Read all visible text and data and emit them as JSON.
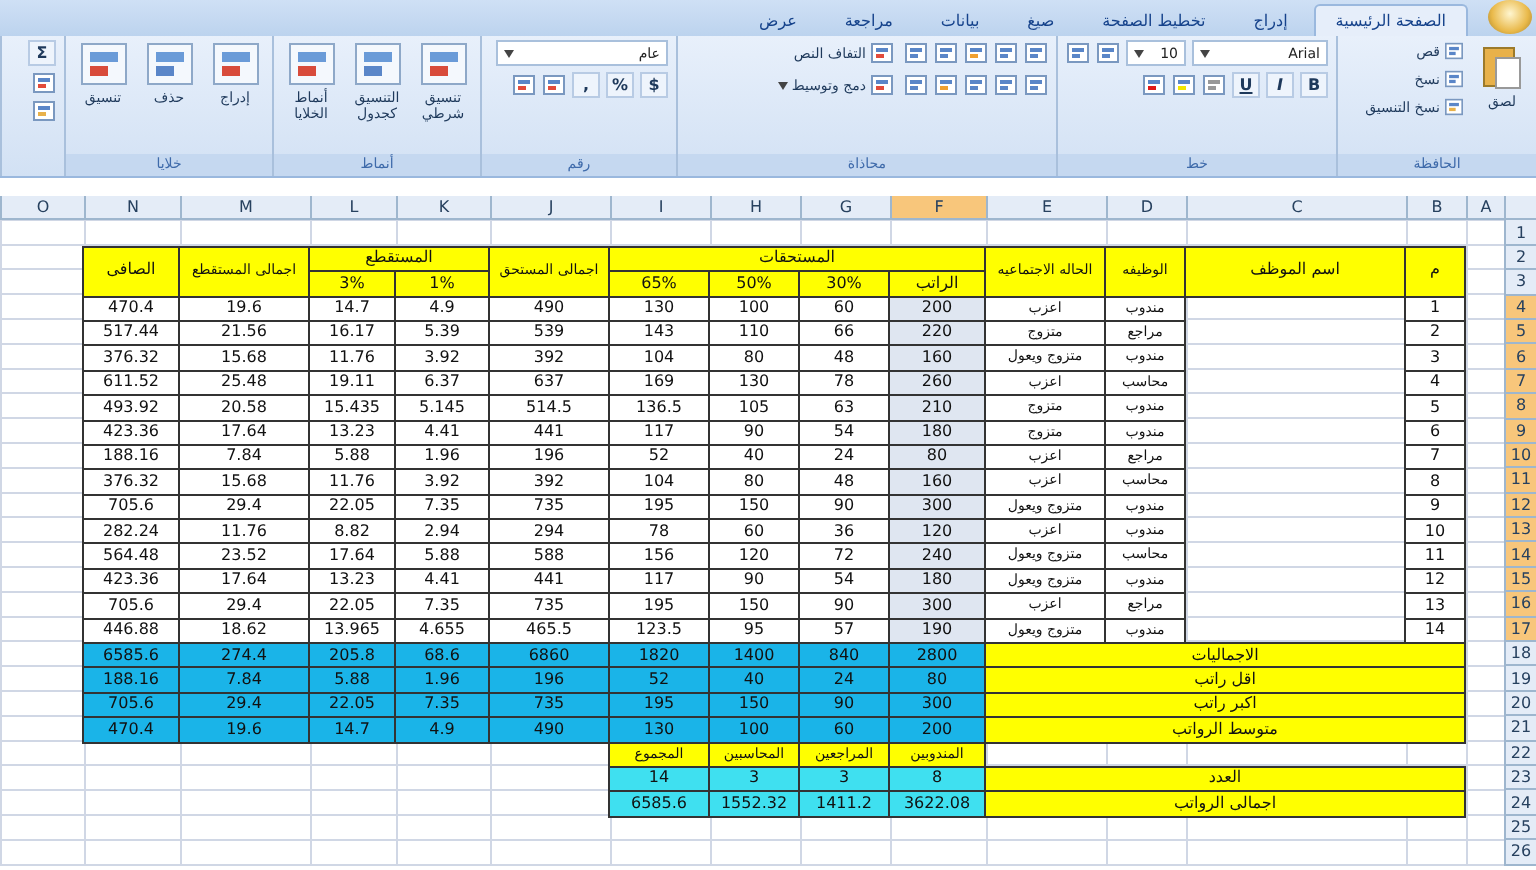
{
  "ribbon": {
    "tabs": [
      {
        "label": "الصفحة الرئيسية",
        "selected": true
      },
      {
        "label": "إدراج",
        "selected": false
      },
      {
        "label": "تخطيط الصفحة",
        "selected": false
      },
      {
        "label": "صيغ",
        "selected": false
      },
      {
        "label": "بيانات",
        "selected": false
      },
      {
        "label": "مراجعة",
        "selected": false
      },
      {
        "label": "عرض",
        "selected": false
      }
    ],
    "groups": [
      {
        "kind": "clipboard",
        "title": "الحافظة",
        "paste": "لصق",
        "items": [
          "قص",
          "نسخ",
          "نسخ التنسيق"
        ]
      },
      {
        "kind": "font",
        "title": "خط",
        "font_name": "Arial",
        "font_size": "10",
        "format_buttons": [
          "B",
          "I",
          "U"
        ]
      },
      {
        "kind": "alignment",
        "title": "محاذاة",
        "wrap": "التفاف النص",
        "merge": "دمج وتوسيط"
      },
      {
        "kind": "number",
        "title": "رقم",
        "format": "عام",
        "symbols": [
          "$",
          "%",
          ","
        ]
      },
      {
        "kind": "styles",
        "title": "أنماط",
        "items": [
          "تنسيق شرطي",
          "التنسيق كجدول",
          "أنماط الخلايا"
        ]
      },
      {
        "kind": "cells",
        "title": "خلايا",
        "items": [
          "إدراج",
          "حذف",
          "تنسيق"
        ]
      },
      {
        "kind": "editing",
        "symbol": "Σ"
      }
    ]
  },
  "sheet": {
    "columns": [
      {
        "label": "A",
        "selected": false
      },
      {
        "label": "B",
        "selected": false
      },
      {
        "label": "C",
        "selected": false
      },
      {
        "label": "D",
        "selected": false
      },
      {
        "label": "E",
        "selected": false
      },
      {
        "label": "F",
        "selected": true
      },
      {
        "label": "G",
        "selected": false
      },
      {
        "label": "H",
        "selected": false
      },
      {
        "label": "I",
        "selected": false
      },
      {
        "label": "J",
        "selected": false
      },
      {
        "label": "K",
        "selected": false
      },
      {
        "label": "L",
        "selected": false
      },
      {
        "label": "M",
        "selected": false
      },
      {
        "label": "N",
        "selected": false
      },
      {
        "label": "O",
        "selected": false
      }
    ],
    "rows": [
      {
        "label": "1",
        "selected": false
      },
      {
        "label": "2",
        "selected": false
      },
      {
        "label": "3",
        "selected": false
      },
      {
        "label": "4",
        "selected": true
      },
      {
        "label": "5",
        "selected": true
      },
      {
        "label": "6",
        "selected": true
      },
      {
        "label": "7",
        "selected": true
      },
      {
        "label": "8",
        "selected": true
      },
      {
        "label": "9",
        "selected": true
      },
      {
        "label": "10",
        "selected": true
      },
      {
        "label": "11",
        "selected": true
      },
      {
        "label": "12",
        "selected": true
      },
      {
        "label": "13",
        "selected": true
      },
      {
        "label": "14",
        "selected": true
      },
      {
        "label": "15",
        "selected": true
      },
      {
        "label": "16",
        "selected": true
      },
      {
        "label": "17",
        "selected": true
      },
      {
        "label": "18",
        "selected": false
      },
      {
        "label": "19",
        "selected": false
      },
      {
        "label": "20",
        "selected": false
      },
      {
        "label": "21",
        "selected": false
      },
      {
        "label": "22",
        "selected": false
      },
      {
        "label": "23",
        "selected": false
      },
      {
        "label": "24",
        "selected": false
      },
      {
        "label": "25",
        "selected": false
      },
      {
        "label": "26",
        "selected": false
      }
    ]
  },
  "table": {
    "headers": {
      "number": "م",
      "name": "اسم الموظف",
      "job": "الوظيفه",
      "status": "الحاله الاجتماعيه",
      "salary": "الراتب",
      "allowances": "المستحقات",
      "allowance_rates": [
        "30%",
        "50%",
        "65%"
      ],
      "total_due": "اجمالى المستحق",
      "deductions": "المستقطع",
      "deduction_rates": [
        "1%",
        "3%"
      ],
      "total_deductions": "اجمالى المستقطع",
      "net": "الصافى"
    },
    "employees": [
      {
        "number": "1",
        "job": "مندوب",
        "status": "اعزب",
        "values": [
          "200",
          "60",
          "100",
          "130",
          "490",
          "4.9",
          "14.7",
          "19.6",
          "470.4"
        ]
      },
      {
        "number": "2",
        "job": "مراجع",
        "status": "متزوج",
        "values": [
          "220",
          "66",
          "110",
          "143",
          "539",
          "5.39",
          "16.17",
          "21.56",
          "517.44"
        ]
      },
      {
        "number": "3",
        "job": "مندوب",
        "status": "متزوج ويعول",
        "values": [
          "160",
          "48",
          "80",
          "104",
          "392",
          "3.92",
          "11.76",
          "15.68",
          "376.32"
        ]
      },
      {
        "number": "4",
        "job": "محاسب",
        "status": "اعزب",
        "values": [
          "260",
          "78",
          "130",
          "169",
          "637",
          "6.37",
          "19.11",
          "25.48",
          "611.52"
        ]
      },
      {
        "number": "5",
        "job": "مندوب",
        "status": "متزوج",
        "values": [
          "210",
          "63",
          "105",
          "136.5",
          "514.5",
          "5.145",
          "15.435",
          "20.58",
          "493.92"
        ]
      },
      {
        "number": "6",
        "job": "مندوب",
        "status": "متزوج",
        "values": [
          "180",
          "54",
          "90",
          "117",
          "441",
          "4.41",
          "13.23",
          "17.64",
          "423.36"
        ]
      },
      {
        "number": "7",
        "job": "مراجع",
        "status": "اعزب",
        "values": [
          "80",
          "24",
          "40",
          "52",
          "196",
          "1.96",
          "5.88",
          "7.84",
          "188.16"
        ]
      },
      {
        "number": "8",
        "job": "محاسب",
        "status": "اعزب",
        "values": [
          "160",
          "48",
          "80",
          "104",
          "392",
          "3.92",
          "11.76",
          "15.68",
          "376.32"
        ]
      },
      {
        "number": "9",
        "job": "مندوب",
        "status": "متزوج ويعول",
        "values": [
          "300",
          "90",
          "150",
          "195",
          "735",
          "7.35",
          "22.05",
          "29.4",
          "705.6"
        ]
      },
      {
        "number": "10",
        "job": "مندوب",
        "status": "اعزب",
        "values": [
          "120",
          "36",
          "60",
          "78",
          "294",
          "2.94",
          "8.82",
          "11.76",
          "282.24"
        ]
      },
      {
        "number": "11",
        "job": "محاسب",
        "status": "متزوج ويعول",
        "values": [
          "240",
          "72",
          "120",
          "156",
          "588",
          "5.88",
          "17.64",
          "23.52",
          "564.48"
        ]
      },
      {
        "number": "12",
        "job": "مندوب",
        "status": "متزوج ويعول",
        "values": [
          "180",
          "54",
          "90",
          "117",
          "441",
          "4.41",
          "13.23",
          "17.64",
          "423.36"
        ]
      },
      {
        "number": "13",
        "job": "مراجع",
        "status": "اعزب",
        "values": [
          "300",
          "90",
          "150",
          "195",
          "735",
          "7.35",
          "22.05",
          "29.4",
          "705.6"
        ]
      },
      {
        "number": "14",
        "job": "مندوب",
        "status": "متزوج ويعول",
        "values": [
          "190",
          "57",
          "95",
          "123.5",
          "465.5",
          "4.655",
          "13.965",
          "18.62",
          "446.88"
        ]
      }
    ],
    "summary": [
      {
        "label": "الاجماليات",
        "values": [
          "2800",
          "840",
          "1400",
          "1820",
          "6860",
          "68.6",
          "205.8",
          "274.4",
          "6585.6"
        ]
      },
      {
        "label": "اقل راتب",
        "values": [
          "80",
          "24",
          "40",
          "52",
          "196",
          "1.96",
          "5.88",
          "7.84",
          "188.16"
        ]
      },
      {
        "label": "اكبر راتب",
        "values": [
          "300",
          "90",
          "150",
          "195",
          "735",
          "7.35",
          "22.05",
          "29.4",
          "705.6"
        ]
      },
      {
        "label": "متوسط الرواتب",
        "values": [
          "200",
          "60",
          "100",
          "130",
          "490",
          "4.9",
          "14.7",
          "19.6",
          "470.4"
        ]
      }
    ],
    "breakdown": {
      "headers": [
        "المندوبين",
        "المراجعين",
        "المحاسبين",
        "المجموع"
      ],
      "rows": [
        {
          "label": "العدد",
          "values": [
            "8",
            "3",
            "3",
            "14"
          ]
        },
        {
          "label": "اجمالى الرواتب",
          "values": [
            "3622.08",
            "1411.2",
            "1552.32",
            "6585.6"
          ]
        }
      ]
    }
  }
}
